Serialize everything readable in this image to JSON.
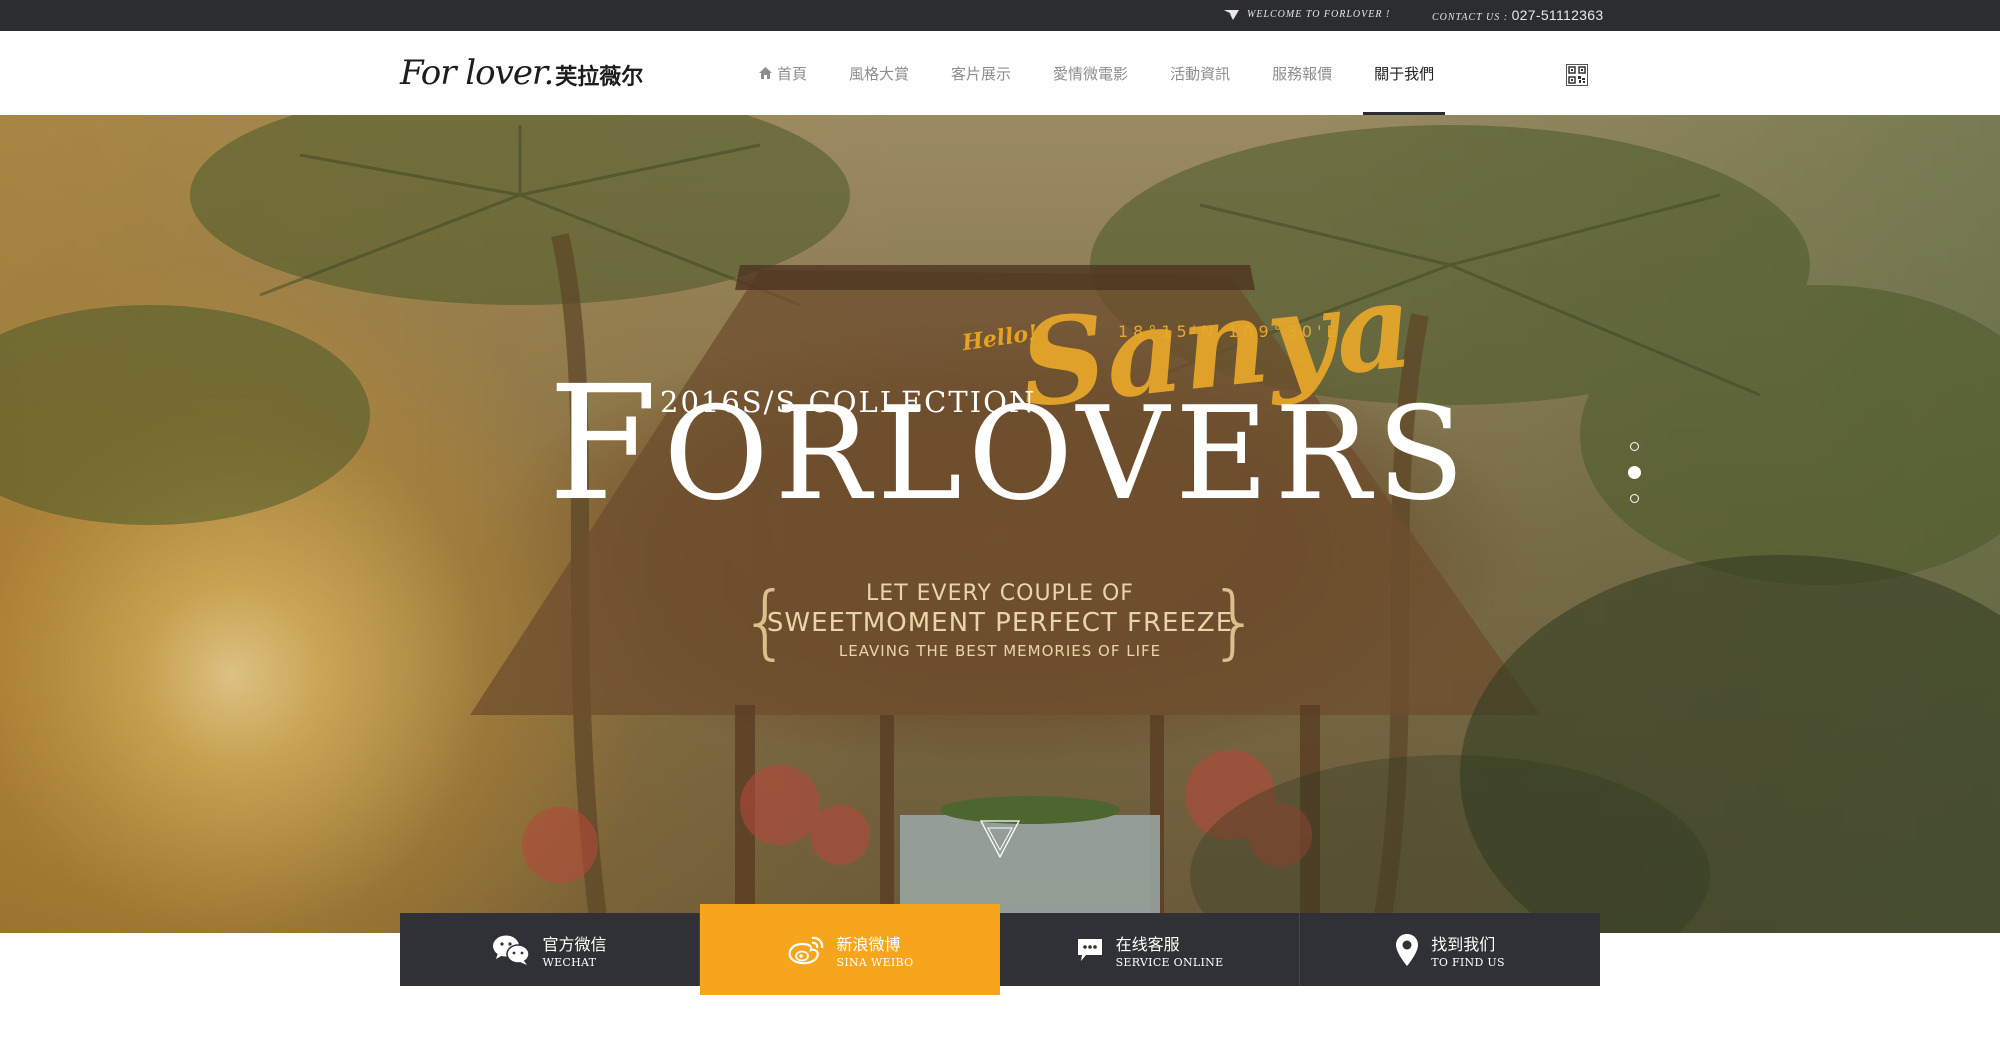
{
  "topbar": {
    "welcome": "WELCOME TO FORLOVER !",
    "contact_label": "CONTACT US :",
    "phone": "027-51112363"
  },
  "header": {
    "logo_script": "For lover.",
    "logo_cn": "芙拉薇尔",
    "nav": [
      {
        "label": "首頁",
        "icon": "home-icon"
      },
      {
        "label": "風格大賞"
      },
      {
        "label": "客片展示"
      },
      {
        "label": "愛情微電影"
      },
      {
        "label": "活動資訊"
      },
      {
        "label": "服務報價"
      },
      {
        "label": "關于我們",
        "active": true
      }
    ],
    "qr_icon": "qr-code-icon"
  },
  "hero": {
    "collection": "2016S/S COLLECTION",
    "brand_first": "F",
    "brand_rest": "ORLOVERS",
    "hello": "Hello!",
    "script": "Sanya",
    "coords": "18°15'N 109°30'E",
    "tag_line1": "LET EVERY COUPLE OF",
    "tag_line2": "SWEETMOMENT PERFECT FREEZE",
    "tag_line3": "LEAVING THE BEST MEMORIES OF LIFE",
    "slides": 3,
    "active_slide": 2
  },
  "social": [
    {
      "cn": "官方微信",
      "en": "WECHAT",
      "icon": "wechat-icon"
    },
    {
      "cn": "新浪微博",
      "en": "SINA WEIBO",
      "icon": "weibo-icon",
      "active": true
    },
    {
      "cn": "在线客服",
      "en": "SERVICE ONLINE",
      "icon": "chat-icon"
    },
    {
      "cn": "找到我们",
      "en": "TO  FIND US",
      "icon": "location-pin-icon"
    }
  ],
  "colors": {
    "topbar": "#2b2d31",
    "accent": "#f7a51c",
    "tile": "#2f3136",
    "gold_script": "#e9a82a"
  }
}
